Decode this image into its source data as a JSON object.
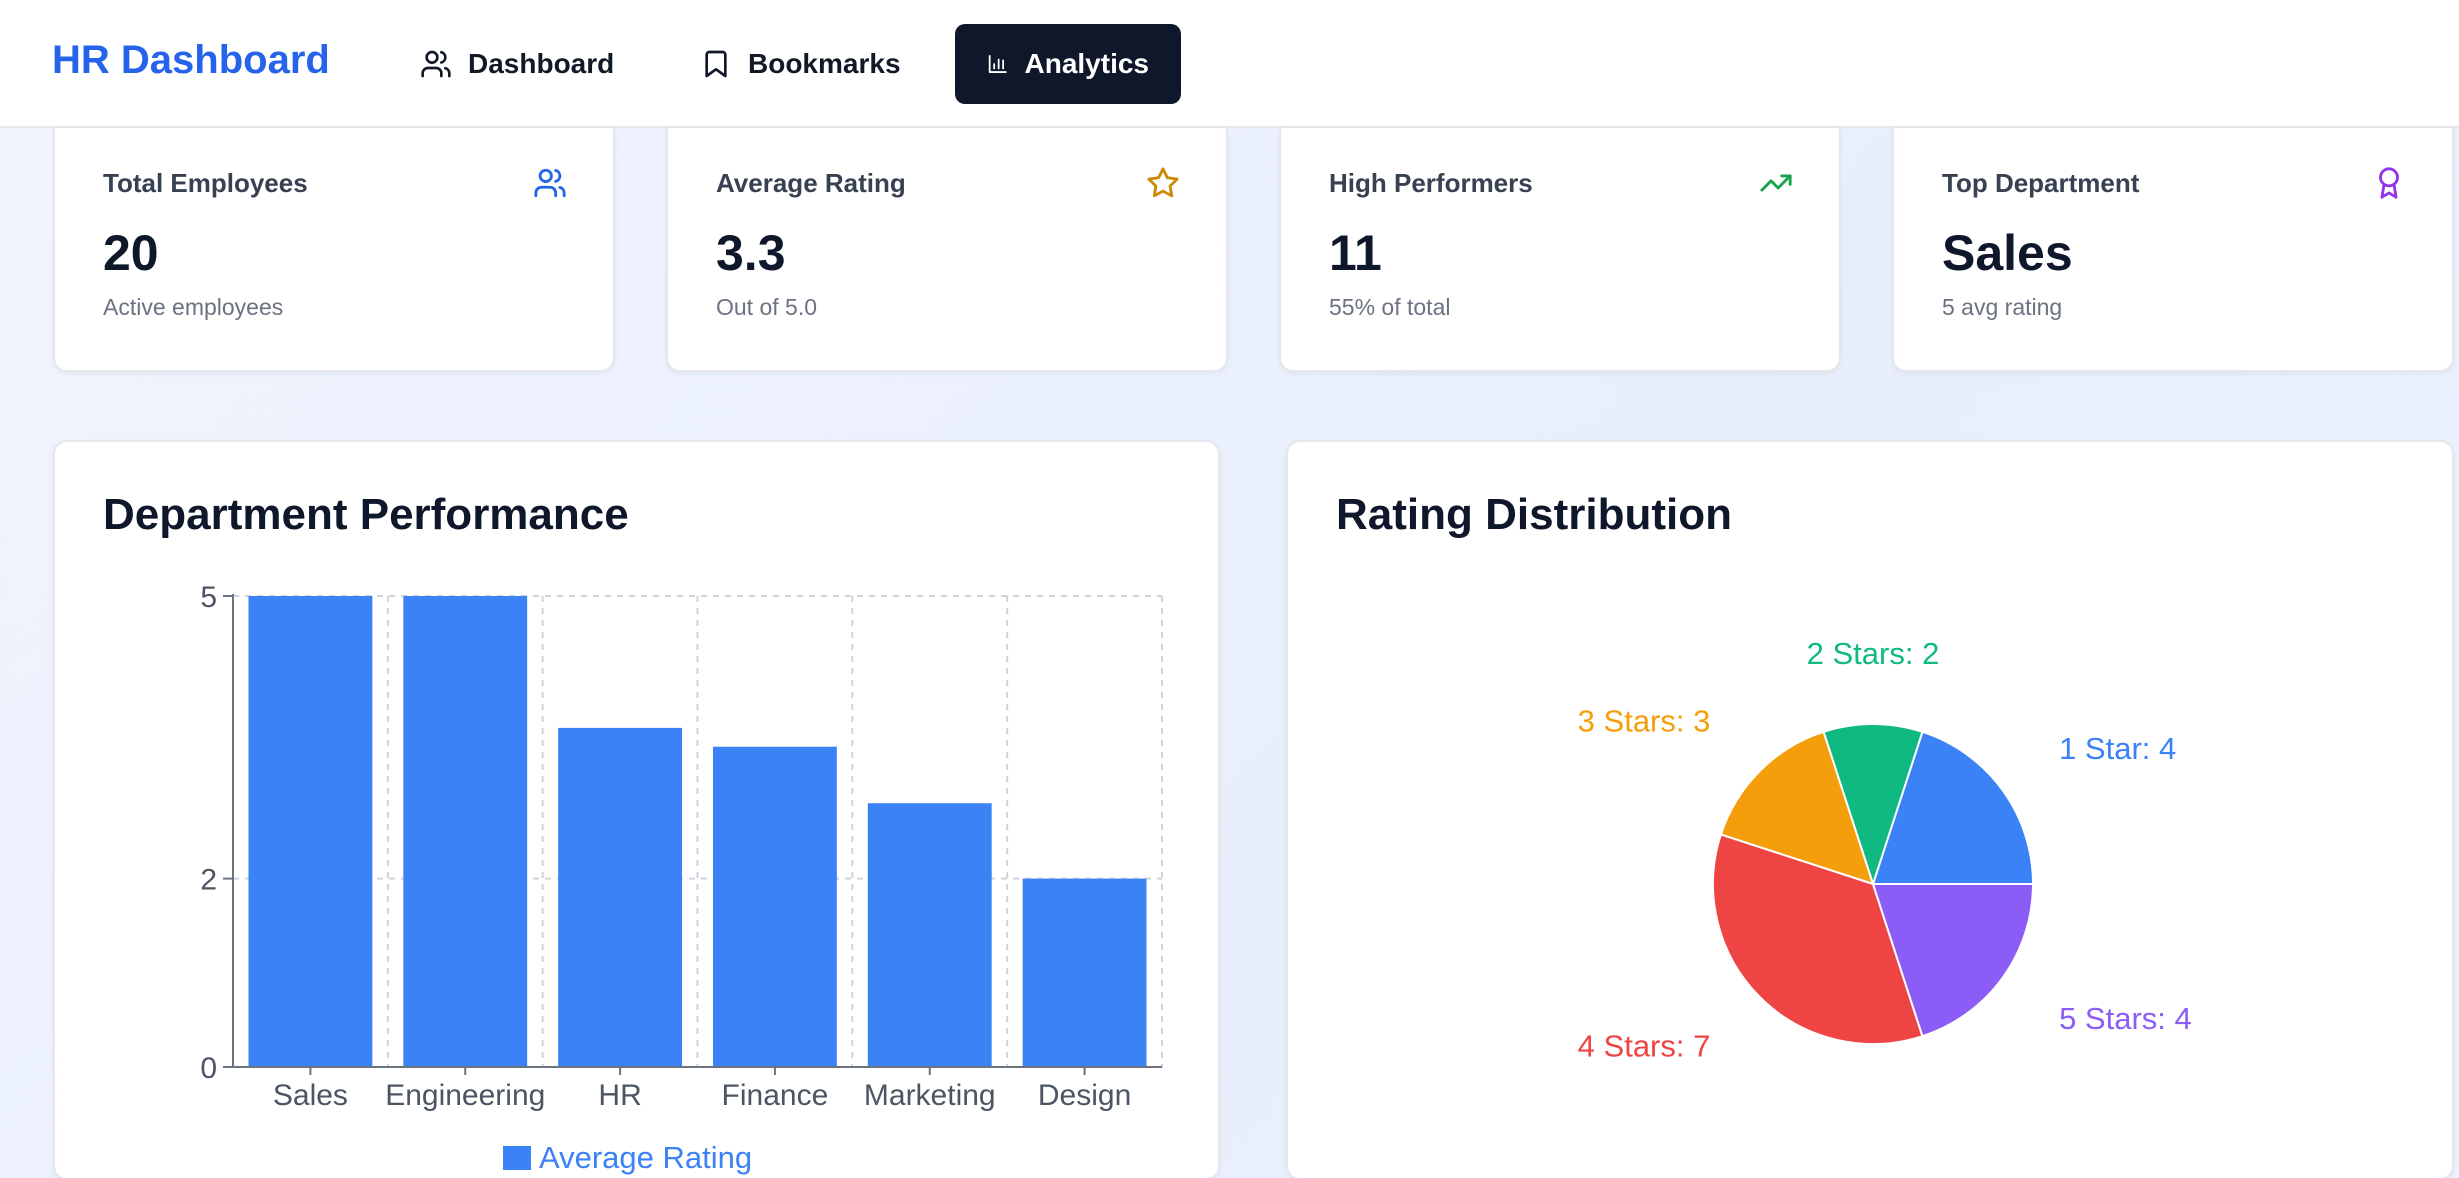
{
  "header": {
    "brand": "HR Dashboard",
    "nav": [
      {
        "label": "Dashboard",
        "icon": "users-icon",
        "active": false
      },
      {
        "label": "Bookmarks",
        "icon": "bookmark-icon",
        "active": false
      },
      {
        "label": "Analytics",
        "icon": "bar-chart-icon",
        "active": true
      }
    ]
  },
  "stats": [
    {
      "title": "Total Employees",
      "value": "20",
      "sub": "Active employees",
      "icon": "users-icon",
      "color": "#2563eb"
    },
    {
      "title": "Average Rating",
      "value": "3.3",
      "sub": "Out of 5.0",
      "icon": "star-icon",
      "color": "#ca8a04"
    },
    {
      "title": "High Performers",
      "value": "11",
      "sub": "55% of total",
      "icon": "trending-up-icon",
      "color": "#16a34a"
    },
    {
      "title": "Top Department",
      "value": "Sales",
      "sub": "5 avg rating",
      "icon": "award-icon",
      "color": "#9333ea"
    }
  ],
  "panels": {
    "department": {
      "title": "Department Performance"
    },
    "distribution": {
      "title": "Rating Distribution"
    }
  },
  "colors": {
    "bar": "#3b82f6",
    "pie": [
      "#3b82f6",
      "#10b981",
      "#f59e0b",
      "#ef4444",
      "#8b5cf6"
    ]
  },
  "chart_data": [
    {
      "type": "bar",
      "categories": [
        "Sales",
        "Engineering",
        "HR",
        "Finance",
        "Marketing",
        "Design"
      ],
      "series": [
        {
          "name": "Average Rating",
          "values": [
            5,
            5,
            3.6,
            3.4,
            2.8,
            2
          ]
        }
      ],
      "yticks": [
        "0",
        "2",
        "5"
      ],
      "ylim": [
        0,
        5
      ],
      "grid": true,
      "legend": "bottom"
    },
    {
      "type": "pie",
      "slices": [
        {
          "label": "1 Star: 4",
          "value": 4
        },
        {
          "label": "2 Stars: 2",
          "value": 2
        },
        {
          "label": "3 Stars: 3",
          "value": 3
        },
        {
          "label": "4 Stars: 7",
          "value": 7
        },
        {
          "label": "5 Stars: 4",
          "value": 4
        }
      ],
      "order": [
        0,
        1,
        2,
        3,
        4
      ]
    }
  ]
}
